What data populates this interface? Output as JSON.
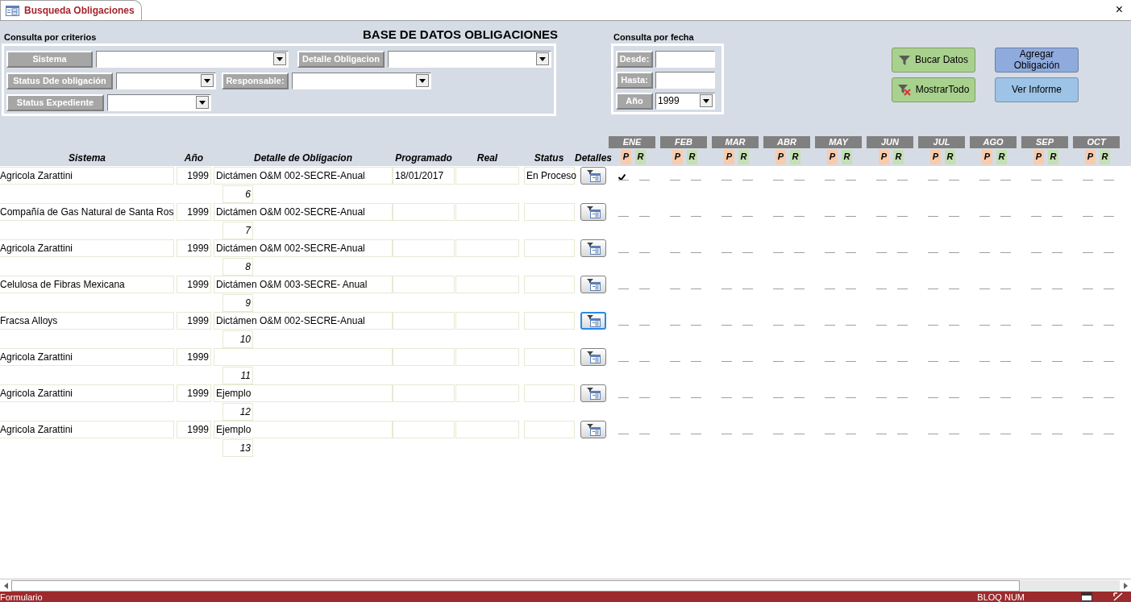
{
  "tab": {
    "title": "Busqueda Obligaciones",
    "close": "×"
  },
  "title": "BASE DE DATOS OBLIGACIONES",
  "criteria": {
    "heading": "Consulta por criterios",
    "rows": [
      [
        {
          "label": "Sistema"
        },
        {
          "label": "Detalle Obligacion"
        }
      ],
      [
        {
          "label": "Status Dde obligación"
        },
        {
          "label": "Responsable:"
        }
      ],
      [
        {
          "label": "Status Expediente"
        }
      ]
    ]
  },
  "date_query": {
    "heading": "Consulta por fecha",
    "fields": [
      {
        "label": "Desde:",
        "kind": "text"
      },
      {
        "label": "Hasta:",
        "kind": "text"
      },
      {
        "label": "Año",
        "kind": "combo",
        "value": "1999"
      }
    ]
  },
  "buttons": [
    {
      "label": "Bucar Datos",
      "kind": "filter",
      "color": "#a9d18e"
    },
    {
      "label": "Agregar Obligación",
      "kind": "plain",
      "color": "#8faadc"
    },
    {
      "label": "MostrarTodo",
      "kind": "clear-filter",
      "color": "#a9d18e"
    },
    {
      "label": "Ver Informe",
      "kind": "plain",
      "color": "#9dc3e6"
    }
  ],
  "columns": [
    "Sistema",
    "Año",
    "Detalle de Obligacion",
    "Programado",
    "Real",
    "Status",
    "Detalles"
  ],
  "months": [
    {
      "name": "ENE",
      "p": "P",
      "r": "R"
    },
    {
      "name": "FEB",
      "p": "P",
      "r": "R"
    },
    {
      "name": "MAR",
      "p": "P",
      "r": "R"
    },
    {
      "name": "ABR",
      "p": "P",
      "r": "R"
    },
    {
      "name": "MAY",
      "p": "P",
      "r": "R"
    },
    {
      "name": "JUN",
      "p": "P",
      "r": "R"
    },
    {
      "name": "JUL",
      "p": "P",
      "r": "R"
    },
    {
      "name": "AGO",
      "p": "P",
      "r": "R"
    },
    {
      "name": "SEP",
      "p": "P",
      "r": "R"
    },
    {
      "name": "OCT",
      "p": "P",
      "r": "R"
    }
  ],
  "rows": [
    {
      "sistema": "Agricola Zarattini",
      "anio": "1999",
      "detalle": "Dictámen O&M 002-SECRE-Anual",
      "programado": "18/01/2017",
      "status": "En Proceso",
      "number": "6",
      "focused": false,
      "p_checks": [
        true,
        false,
        false,
        false,
        false,
        false,
        false,
        false,
        false,
        false
      ],
      "r_checks": [
        false,
        false,
        false,
        false,
        false,
        false,
        false,
        false,
        false,
        false
      ]
    },
    {
      "sistema": "Compañía de Gas Natural de Santa Ros",
      "anio": "1999",
      "detalle": "Dictámen O&M 002-SECRE-Anual",
      "number": "7",
      "focused": false,
      "p_checks": [
        false,
        false,
        false,
        false,
        false,
        false,
        false,
        false,
        false,
        false
      ],
      "r_checks": [
        false,
        false,
        false,
        false,
        false,
        false,
        false,
        false,
        false,
        false
      ]
    },
    {
      "sistema": "Agricola Zarattini",
      "anio": "1999",
      "detalle": "Dictámen O&M 002-SECRE-Anual",
      "number": "8",
      "focused": false,
      "p_checks": [
        false,
        false,
        false,
        false,
        false,
        false,
        false,
        false,
        false,
        false
      ],
      "r_checks": [
        false,
        false,
        false,
        false,
        false,
        false,
        false,
        false,
        false,
        false
      ]
    },
    {
      "sistema": "Celulosa de Fibras Mexicana",
      "anio": "1999",
      "detalle": "Dictámen O&M 003-SECRE- Anual",
      "number": "9",
      "focused": false,
      "p_checks": [
        false,
        false,
        false,
        false,
        false,
        false,
        false,
        false,
        false,
        false
      ],
      "r_checks": [
        false,
        false,
        false,
        false,
        false,
        false,
        false,
        false,
        false,
        false
      ]
    },
    {
      "sistema": "Fracsa Alloys",
      "anio": "1999",
      "detalle": "Dictámen O&M 002-SECRE-Anual",
      "number": "10",
      "focused": true,
      "p_checks": [
        false,
        false,
        false,
        false,
        false,
        false,
        false,
        false,
        false,
        false
      ],
      "r_checks": [
        false,
        false,
        false,
        false,
        false,
        false,
        false,
        false,
        false,
        false
      ]
    },
    {
      "sistema": "Agricola Zarattini",
      "anio": "1999",
      "number": "11",
      "focused": false,
      "p_checks": [
        false,
        false,
        false,
        false,
        false,
        false,
        false,
        false,
        false,
        false
      ],
      "r_checks": [
        false,
        false,
        false,
        false,
        false,
        false,
        false,
        false,
        false,
        false
      ]
    },
    {
      "sistema": "Agricola Zarattini",
      "anio": "1999",
      "detalle": "Ejemplo",
      "number": "12",
      "focused": false,
      "p_checks": [
        false,
        false,
        false,
        false,
        false,
        false,
        false,
        false,
        false,
        false
      ],
      "r_checks": [
        false,
        false,
        false,
        false,
        false,
        false,
        false,
        false,
        false,
        false
      ]
    },
    {
      "sistema": "Agricola Zarattini",
      "anio": "1999",
      "detalle": "Ejemplo",
      "number": "13",
      "focused": false,
      "p_checks": [
        false,
        false,
        false,
        false,
        false,
        false,
        false,
        false,
        false,
        false
      ],
      "r_checks": [
        false,
        false,
        false,
        false,
        false,
        false,
        false,
        false,
        false,
        false
      ]
    }
  ],
  "status_bar": {
    "left": "Formulario",
    "right": "BLOQ NUM"
  }
}
